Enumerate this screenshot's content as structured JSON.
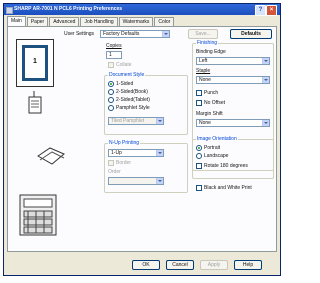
{
  "window": {
    "title": "SHARP AR-7001 N PCL6 Printing Preferences",
    "help": "?",
    "close": "×"
  },
  "tabs": [
    "Main",
    "Paper",
    "Advanced",
    "Job Handling",
    "Watermarks",
    "Color"
  ],
  "user_settings": {
    "label": "User Settings",
    "value": "Factory Defaults",
    "save": "Save...",
    "defaults": "Defaults"
  },
  "preview": {
    "page_number": "1"
  },
  "copies": {
    "label": "Copies",
    "value": "1",
    "collate": "Collate"
  },
  "document_style": {
    "title": "Document Style",
    "options": [
      "1-Sided",
      "2-Sided(Book)",
      "2-Sided(Tablet)",
      "Pamphlet Style"
    ],
    "selected": 0,
    "pamphlet_select": "Tiled Pamphlet"
  },
  "n_up": {
    "title": "N-Up Printing",
    "value": "1-Up",
    "border": "Border",
    "order": "Order",
    "order_value": ""
  },
  "finishing": {
    "title": "Finishing",
    "binding_edge_label": "Binding Edge",
    "binding_edge_value": "Left",
    "staple_label": "Staple",
    "staple_value": "None",
    "punch": "Punch",
    "no_offset": "No Offset",
    "margin_shift_label": "Margin Shift",
    "margin_shift_value": "None"
  },
  "orientation": {
    "title": "Image Orientation",
    "options": [
      "Portrait",
      "Landscape"
    ],
    "selected": 0,
    "rotate": "Rotate 180 degrees"
  },
  "black_white": "Black and White Print",
  "footer": {
    "ok": "OK",
    "cancel": "Cancel",
    "apply": "Apply",
    "help": "Help"
  }
}
